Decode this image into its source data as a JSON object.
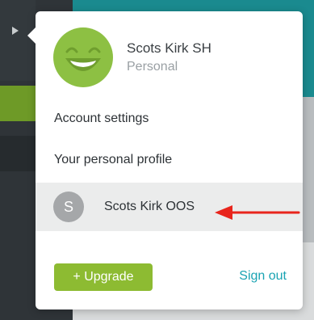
{
  "account": {
    "name": "Scots Kirk SH",
    "type": "Personal",
    "avatar_icon": "smiley-face-icon",
    "avatar_color": "#8dc043"
  },
  "menu": {
    "account_settings": "Account settings",
    "personal_profile": "Your personal profile"
  },
  "switch_account": {
    "initial": "S",
    "name": "Scots Kirk OOS",
    "annotation_icon": "red-arrow-icon",
    "annotation_color": "#e8251c"
  },
  "footer": {
    "upgrade_label": "+ Upgrade",
    "sign_out_label": "Sign out"
  },
  "colors": {
    "accent_green": "#8dbb32",
    "link_teal": "#1aa3b3",
    "background_teal": "#1a8a8f"
  }
}
